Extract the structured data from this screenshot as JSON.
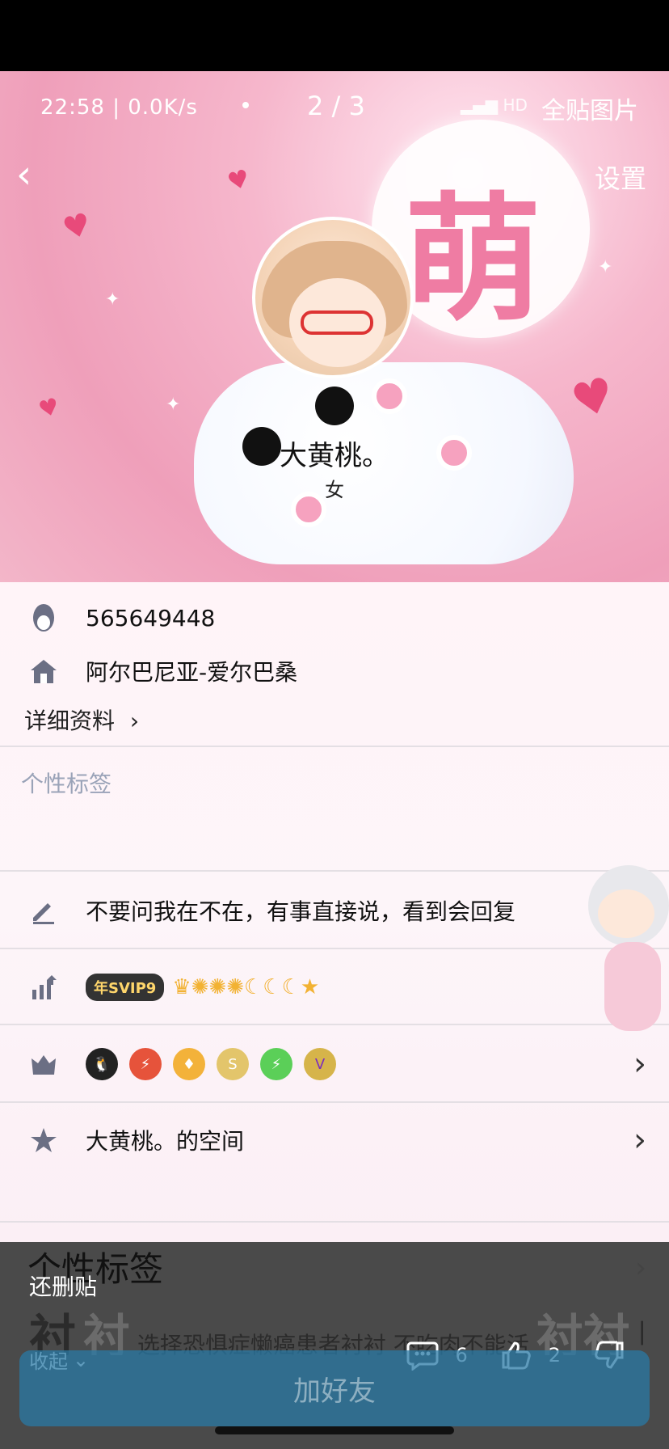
{
  "status_bar": {
    "time_speed": "22:58 | 0.0K/s",
    "page_indicator": "2 / 3",
    "full_post_image": "全贴图片"
  },
  "header": {
    "back_icon": "back-chevron-icon",
    "settings_label": "设置",
    "username": "大黄桃。",
    "gender": "女"
  },
  "profile": {
    "qq_number": "565649448",
    "location": "阿尔巴尼亚-爱尔巴桑",
    "detail_link": "详细资料",
    "signature_label": "个性标签",
    "status_text": "不要问我在不在，有事直接说，看到会回复",
    "vip_badge": "年SVIP9",
    "space_label": "大黄桃。的空间"
  },
  "badges": [
    {
      "icon": "qq-penguin-icon",
      "color": "#222222"
    },
    {
      "icon": "lightning-lv9-icon",
      "color": "#e6533b"
    },
    {
      "icon": "diamond-heart-icon",
      "color": "#f3b23a"
    },
    {
      "icon": "svip5-icon",
      "color": "#e3c56b"
    },
    {
      "icon": "lv8-icon",
      "color": "#5bcf58"
    },
    {
      "icon": "v1-icon",
      "color": "#d6b44a"
    }
  ],
  "overlay": {
    "signature_title": "个性标签",
    "deleted_tag": "还删贴",
    "collapse_label": "收起",
    "comment_count": "6",
    "like_count": "2",
    "add_friend_label": "加好友",
    "ribbon": {
      "big1": "衬",
      "big2": "衬",
      "mid_text": "选择恐惧症懒癌患者衬衬",
      "line2": "不吃肉不能活",
      "tail": "衬衬",
      "end": "中"
    }
  }
}
